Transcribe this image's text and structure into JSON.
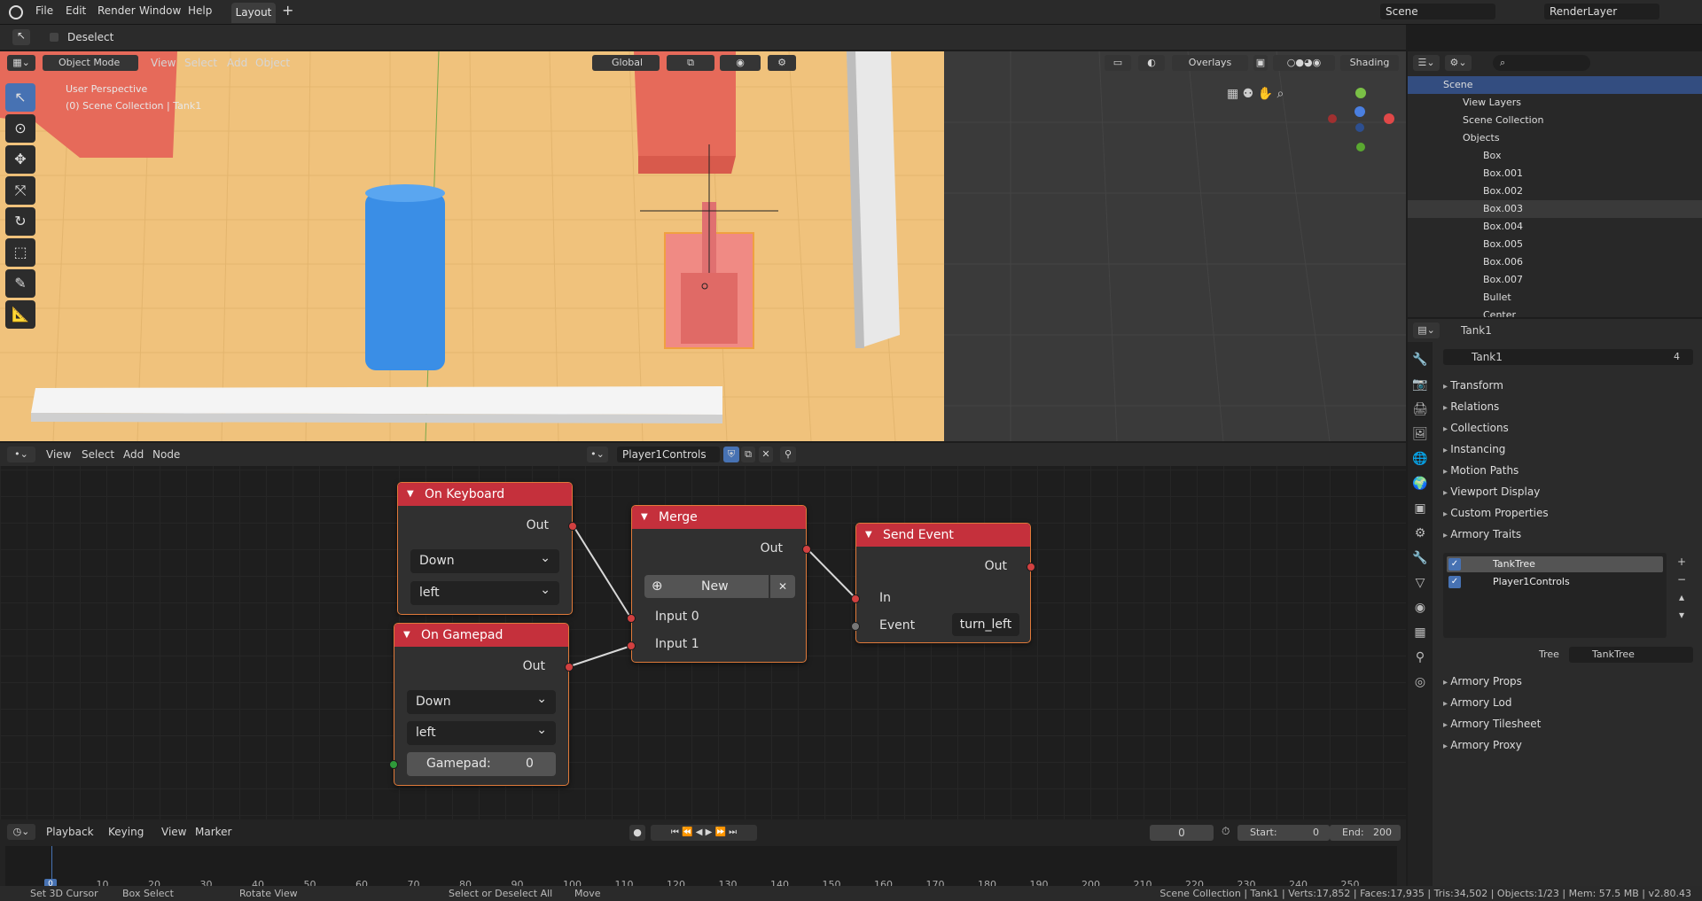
{
  "menu": {
    "file": "File",
    "edit": "Edit",
    "render": "Render",
    "window": "Window",
    "help": "Help",
    "workspace_tab": "Layout",
    "scene": "Scene",
    "render_layer": "RenderLayer"
  },
  "tool_header": {
    "deselect": "Deselect"
  },
  "viewport": {
    "mode": "Object Mode",
    "view": "View",
    "select": "Select",
    "add": "Add",
    "object": "Object",
    "orientation": "Global",
    "overlays": "Overlays",
    "shading": "Shading",
    "perspective": "User Perspective",
    "collection": "(0) Scene Collection | Tank1"
  },
  "node_editor": {
    "view": "View",
    "select": "Select",
    "add": "Add",
    "node": "Node",
    "tree_name": "Player1Controls",
    "nodes": {
      "keyboard": {
        "title": "On Keyboard",
        "out": "Out",
        "state": "Down",
        "key": "left"
      },
      "gamepad": {
        "title": "On Gamepad",
        "out": "Out",
        "state": "Down",
        "key": "left",
        "gamepad_label": "Gamepad:",
        "gamepad_value": "0"
      },
      "merge": {
        "title": "Merge",
        "out": "Out",
        "new": "New",
        "input0": "Input 0",
        "input1": "Input 1"
      },
      "send_event": {
        "title": "Send Event",
        "out": "Out",
        "in": "In",
        "event": "Event",
        "event_value": "turn_left"
      }
    }
  },
  "timeline": {
    "playback": "Playback",
    "keying": "Keying",
    "view": "View",
    "marker": "Marker",
    "current_frame": "0",
    "start_label": "Start:",
    "start": "0",
    "end_label": "End:",
    "end": "200",
    "ticks": [
      "0",
      "10",
      "20",
      "30",
      "40",
      "50",
      "60",
      "70",
      "80",
      "90",
      "100",
      "110",
      "120",
      "130",
      "140",
      "150",
      "160",
      "170",
      "180",
      "190",
      "200",
      "210",
      "220",
      "230",
      "240",
      "250"
    ]
  },
  "outliner": {
    "scene": "Scene",
    "items": [
      "View Layers",
      "Scene Collection",
      "Objects",
      "Box",
      "Box.001",
      "Box.002",
      "Box.003",
      "Box.004",
      "Box.005",
      "Box.006",
      "Box.007",
      "Bullet",
      "Center"
    ]
  },
  "properties": {
    "object_name": "Tank1",
    "users": "4",
    "sections": [
      "Transform",
      "Relations",
      "Collections",
      "Instancing",
      "Motion Paths",
      "Viewport Display",
      "Custom Properties"
    ],
    "armory_traits": "Armory Traits",
    "traits": [
      "TankTree",
      "Player1Controls"
    ],
    "tree_label": "Tree",
    "tree_value": "TankTree",
    "sections2": [
      "Armory Props",
      "Armory Lod",
      "Armory Tilesheet",
      "Armory Proxy"
    ]
  },
  "statusbar": {
    "cursor": "Set 3D Cursor",
    "box": "Box Select",
    "rotate": "Rotate View",
    "select_all": "Select or Deselect All",
    "move": "Move",
    "stats": "Scene Collection | Tank1 | Verts:17,852 | Faces:17,935 | Tris:34,502 | Objects:1/23 | Mem: 57.5 MB | v2.80.43"
  },
  "colors": {
    "accent": "#4772b3",
    "node_header": "#c5303c",
    "socket": "#d24040",
    "floor": "#f1c27a"
  }
}
